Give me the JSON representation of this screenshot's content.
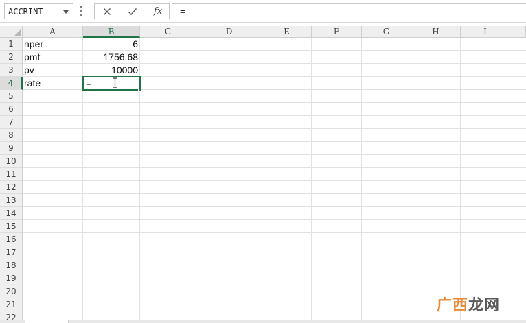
{
  "formula_bar": {
    "name_box": "ACCRINT",
    "formula": "=",
    "icons": {
      "cancel": "close-icon",
      "enter": "check-icon",
      "function": "function-icon"
    },
    "fx_label": "fx"
  },
  "columns": [
    "A",
    "B",
    "C",
    "D",
    "E",
    "F",
    "G",
    "H",
    "I"
  ],
  "rows": [
    "1",
    "2",
    "3",
    "4",
    "5",
    "6",
    "7",
    "8",
    "9",
    "10",
    "11",
    "12",
    "13",
    "14",
    "15",
    "16",
    "17",
    "18",
    "19",
    "20",
    "21",
    "22"
  ],
  "selected_cell": {
    "column": "B",
    "row": "4"
  },
  "cells": {
    "A1": "nper",
    "B1": "6",
    "A2": "pmt",
    "B2": "1756.68",
    "A3": "pv",
    "B3": "10000",
    "A4": "rate",
    "B4": "="
  },
  "watermark": {
    "part1": "广西",
    "part2": "龙网"
  },
  "colors": {
    "accent": "#217346",
    "header_bg": "#efefef",
    "gridline": "#e2e2e2"
  }
}
